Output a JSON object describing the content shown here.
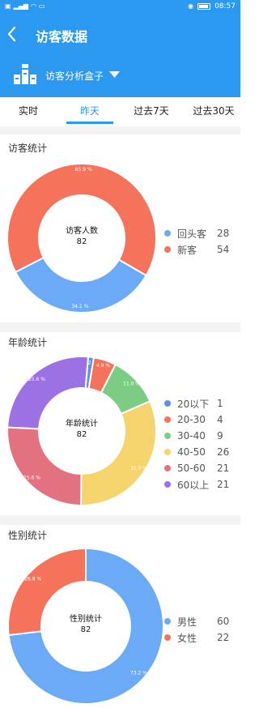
{
  "status_bar": {
    "time": "08:57",
    "battery": "▮"
  },
  "nav": {
    "title": "访客数据"
  },
  "store": {
    "name": "访客分析盒子"
  },
  "tabs": [
    {
      "label": "实时",
      "active": false
    },
    {
      "label": "昨天",
      "active": true
    },
    {
      "label": "过去7天",
      "active": false
    },
    {
      "label": "过去30天",
      "active": false
    }
  ],
  "sections": {
    "visitor": {
      "title": "访客统计"
    },
    "age": {
      "title": "年龄统计"
    },
    "gender": {
      "title": "性别统计"
    }
  },
  "colors": {
    "header": "#2b99f0",
    "tab_active": "#2b99f0",
    "blue": "#6aaaf6",
    "red": "#f4735a",
    "green": "#7dcc84",
    "yellow": "#f5d46d",
    "pink": "#e2727f",
    "purple": "#9b71e3",
    "blue_alt": "#5b93ea"
  },
  "chart_data": [
    {
      "type": "pie",
      "center_title": "访客人数",
      "center_value": "82",
      "series": [
        {
          "name": "回头客",
          "value": 28,
          "color": "#6aaaf6",
          "label": "34.1 %"
        },
        {
          "name": "新客",
          "value": 54,
          "color": "#f4735a",
          "label": "65.9 %"
        }
      ]
    },
    {
      "type": "pie",
      "center_title": "年龄统计",
      "center_value": "82",
      "series": [
        {
          "name": "20以下",
          "value": 1,
          "color": "#5b93ea",
          "label": "1.2 %"
        },
        {
          "name": "20-30",
          "value": 4,
          "color": "#f4735a",
          "label": "4.9 %"
        },
        {
          "name": "30-40",
          "value": 9,
          "color": "#7dcc84",
          "label": "11.0 %"
        },
        {
          "name": "40-50",
          "value": 26,
          "color": "#f5d46d",
          "label": "31.7 %"
        },
        {
          "name": "50-60",
          "value": 21,
          "color": "#e2727f",
          "label": "25.6 %"
        },
        {
          "name": "60以上",
          "value": 21,
          "color": "#9b71e3",
          "label": "25.6 %"
        }
      ]
    },
    {
      "type": "pie",
      "center_title": "性别统计",
      "center_value": "82",
      "series": [
        {
          "name": "男性",
          "value": 60,
          "color": "#6aaaf6",
          "label": "73.2 %"
        },
        {
          "name": "女性",
          "value": 22,
          "color": "#f4735a",
          "label": "26.8 %"
        }
      ]
    }
  ]
}
